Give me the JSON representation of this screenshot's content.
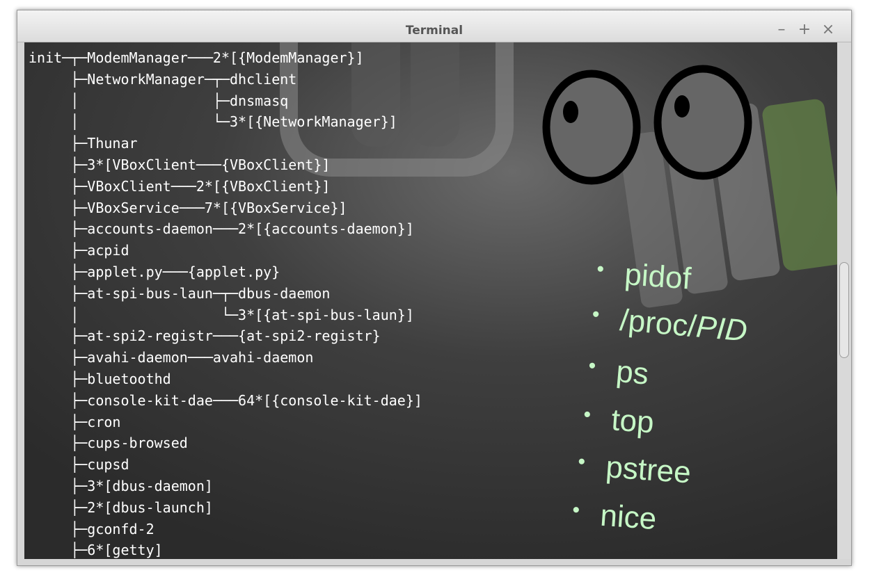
{
  "window": {
    "title": "Terminal",
    "controls": {
      "minimize": "–",
      "maximize": "+",
      "close": "×"
    }
  },
  "terminal": {
    "pstree_lines": [
      "init─┬─ModemManager───2*[{ModemManager}]",
      "     ├─NetworkManager─┬─dhclient",
      "     │                ├─dnsmasq",
      "     │                └─3*[{NetworkManager}]",
      "     ├─Thunar",
      "     ├─3*[VBoxClient───{VBoxClient}]",
      "     ├─VBoxClient───2*[{VBoxClient}]",
      "     ├─VBoxService───7*[{VBoxService}]",
      "     ├─accounts-daemon───2*[{accounts-daemon}]",
      "     ├─acpid",
      "     ├─applet.py───{applet.py}",
      "     ├─at-spi-bus-laun─┬─dbus-daemon",
      "     │                 └─3*[{at-spi-bus-laun}]",
      "     ├─at-spi2-registr───{at-spi2-registr}",
      "     ├─avahi-daemon───avahi-daemon",
      "     ├─bluetoothd",
      "     ├─console-kit-dae───64*[{console-kit-dae}]",
      "     ├─cron",
      "     ├─cups-browsed",
      "     ├─cupsd",
      "     ├─3*[dbus-daemon]",
      "     ├─2*[dbus-launch]",
      "     ├─gconfd-2",
      "     ├─6*[getty]"
    ]
  },
  "overlay": {
    "bullet_char": "•",
    "items": [
      {
        "text": "pidof"
      },
      {
        "text": "/proc/",
        "italic": "PID"
      },
      {
        "text": "ps"
      },
      {
        "text": "top"
      },
      {
        "text": "pstree"
      },
      {
        "text": "nice"
      }
    ]
  },
  "colors": {
    "terminal_bg": "#353535",
    "terminal_text": "#ffffff",
    "overlay_text": "#c6f7c6",
    "titlebar": "#e6e6e6"
  },
  "icons": [
    "eyes-icon",
    "linux-mint-logo"
  ]
}
